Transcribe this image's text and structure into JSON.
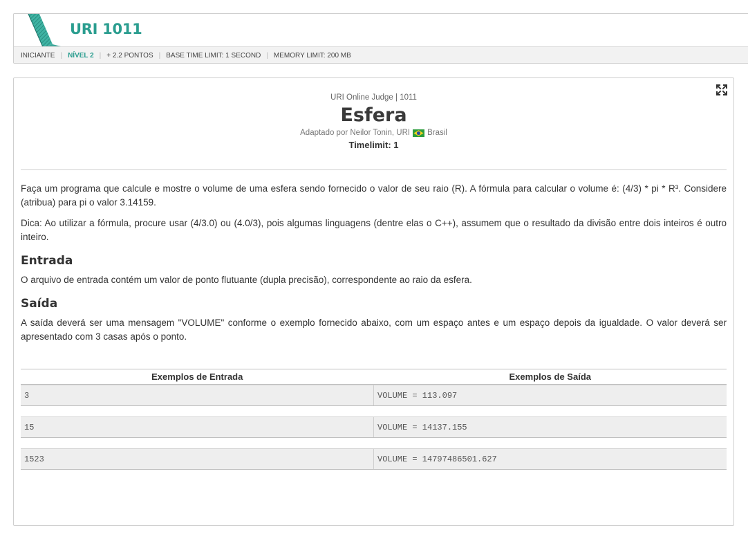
{
  "header": {
    "problem_code": "URI 1011",
    "meta": {
      "category": "INICIANTE",
      "level": "NÍVEL 2",
      "points": "+ 2.2 PONTOS",
      "base_time": "BASE TIME LIMIT: 1 SECOND",
      "memory": "MEMORY LIMIT: 200 MB"
    }
  },
  "problem": {
    "judge_line": "URI Online Judge | 1011",
    "title": "Esfera",
    "author_prefix": "Adaptado por Neilor Tonin, URI",
    "country": "Brasil",
    "timelimit": "Timelimit: 1",
    "description_1": "Faça um programa que calcule e mostre o volume de uma esfera sendo fornecido o valor de seu raio (R). A fórmula para calcular o volume é: (4/3) * pi * R³. Considere (atribua) para pi o valor 3.14159.",
    "description_2": "Dica: Ao utilizar a fórmula, procure usar (4/3.0) ou (4.0/3), pois algumas linguagens (dentre elas o C++), assumem que o resultado da divisão entre dois inteiros é outro inteiro.",
    "input_title": "Entrada",
    "input_text": "O arquivo de entrada contém um valor de ponto flutuante (dupla precisão), correspondente ao raio da esfera.",
    "output_title": "Saída",
    "output_text": "A saída deverá ser uma mensagem \"VOLUME\" conforme o exemplo fornecido abaixo, com um espaço antes e um espaço depois da igualdade. O valor deverá ser apresentado com 3 casas após o ponto."
  },
  "examples": {
    "input_header": "Exemplos de Entrada",
    "output_header": "Exemplos de Saída",
    "rows": [
      {
        "input": "3",
        "output": "VOLUME = 113.097"
      },
      {
        "input": "15",
        "output": "VOLUME = 14137.155"
      },
      {
        "input": "1523",
        "output": "VOLUME = 14797486501.627"
      }
    ]
  },
  "colors": {
    "accent": "#2a9d8f",
    "row_background": "#eeeeee"
  },
  "icons": {
    "logo": "uri-stripe-logo-icon",
    "expand": "expand-icon",
    "flag": "brazil-flag-icon"
  }
}
